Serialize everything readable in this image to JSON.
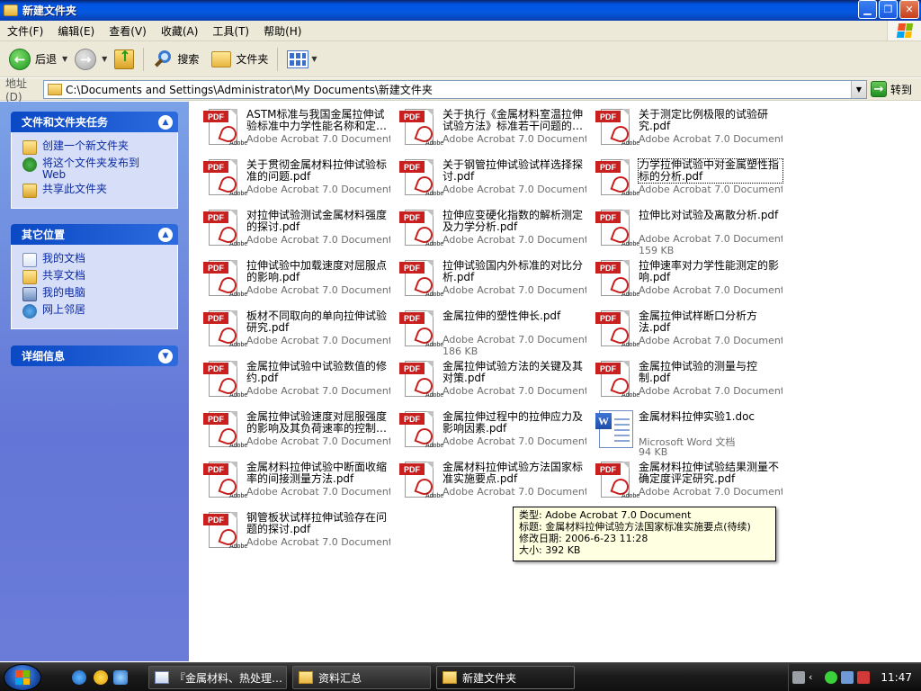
{
  "window": {
    "title": "新建文件夹",
    "controls": {
      "minimize": "▁",
      "maximize": "❐",
      "close": "✕"
    }
  },
  "menu": [
    "文件(F)",
    "编辑(E)",
    "查看(V)",
    "收藏(A)",
    "工具(T)",
    "帮助(H)"
  ],
  "toolbar": {
    "back_label": "后退",
    "search_label": "搜索",
    "folders_label": "文件夹"
  },
  "address": {
    "label": "地址(D)",
    "path": "C:\\Documents and Settings\\Administrator\\My Documents\\新建文件夹",
    "go_label": "转到"
  },
  "taskpane": {
    "file_tasks": {
      "title": "文件和文件夹任务",
      "items": [
        "创建一个新文件夹",
        "将这个文件夹发布到 Web",
        "共享此文件夹"
      ]
    },
    "other_places": {
      "title": "其它位置",
      "items": [
        "我的文档",
        "共享文档",
        "我的电脑",
        "网上邻居"
      ]
    },
    "details": {
      "title": "详细信息"
    }
  },
  "files": [
    {
      "name": "ASTM标准与我国金属拉伸试验标准中力学性能名称和定…",
      "type": "Adobe Acrobat 7.0 Document",
      "kind": "pdf"
    },
    {
      "name": "关于执行《金属材料室温拉伸试验方法》标准若干问题的…",
      "type": "Adobe Acrobat 7.0 Document",
      "kind": "pdf"
    },
    {
      "name": "关于测定比例极限的试验研究.pdf",
      "type": "Adobe Acrobat 7.0 Document",
      "kind": "pdf"
    },
    {
      "name": "关于贯彻金属材料拉伸试验标准的问题.pdf",
      "type": "Adobe Acrobat 7.0 Document",
      "kind": "pdf"
    },
    {
      "name": "关于钢管拉伸试验试样选择探讨.pdf",
      "type": "Adobe Acrobat 7.0 Document",
      "kind": "pdf"
    },
    {
      "name": "力学拉伸试验中对金属塑性指标的分析.pdf",
      "type": "Adobe Acrobat 7.0 Document",
      "kind": "pdf",
      "focused": true
    },
    {
      "name": "对拉伸试验测试金属材料强度的探讨.pdf",
      "type": "Adobe Acrobat 7.0 Document",
      "kind": "pdf"
    },
    {
      "name": "拉伸应变硬化指数的解析测定及力学分析.pdf",
      "type": "Adobe Acrobat 7.0 Document",
      "kind": "pdf"
    },
    {
      "name": "拉伸比对试验及离散分析.pdf",
      "type": "Adobe Acrobat 7.0 Document",
      "size": "159 KB",
      "kind": "pdf"
    },
    {
      "name": "拉伸试验中加载速度对屈服点的影响.pdf",
      "type": "Adobe Acrobat 7.0 Document",
      "kind": "pdf"
    },
    {
      "name": "拉伸试验国内外标准的对比分析.pdf",
      "type": "Adobe Acrobat 7.0 Document",
      "kind": "pdf"
    },
    {
      "name": "拉伸速率对力学性能测定的影响.pdf",
      "type": "Adobe Acrobat 7.0 Document",
      "kind": "pdf"
    },
    {
      "name": "板材不同取向的单向拉伸试验研究.pdf",
      "type": "Adobe Acrobat 7.0 Document",
      "kind": "pdf"
    },
    {
      "name": "金属拉伸的塑性伸长.pdf",
      "type": "Adobe Acrobat 7.0 Document",
      "size": "186 KB",
      "kind": "pdf"
    },
    {
      "name": "金属拉伸试样断口分析方法.pdf",
      "type": "Adobe Acrobat 7.0 Document",
      "kind": "pdf"
    },
    {
      "name": "金属拉伸试验中试验数值的修约.pdf",
      "type": "Adobe Acrobat 7.0 Document",
      "kind": "pdf"
    },
    {
      "name": "金属拉伸试验方法的关键及其对策.pdf",
      "type": "Adobe Acrobat 7.0 Document",
      "kind": "pdf"
    },
    {
      "name": "金属拉伸试验的测量与控制.pdf",
      "type": "Adobe Acrobat 7.0 Document",
      "kind": "pdf"
    },
    {
      "name": "金属拉伸试验速度对屈服强度的影响及其负荷速率的控制…",
      "type": "Adobe Acrobat 7.0 Document",
      "kind": "pdf"
    },
    {
      "name": "金属拉伸过程中的拉伸应力及影响因素.pdf",
      "type": "Adobe Acrobat 7.0 Document",
      "kind": "pdf"
    },
    {
      "name": "金属材料拉伸实验1.doc",
      "type": "Microsoft Word 文档",
      "size": "94 KB",
      "kind": "doc"
    },
    {
      "name": "金属材料拉伸试验中断面收缩率的间接测量方法.pdf",
      "type": "Adobe Acrobat 7.0 Document",
      "kind": "pdf"
    },
    {
      "name": "金属材料拉伸试验方法国家标准实施要点.pdf",
      "type": "Adobe Acrobat 7.0 Document",
      "kind": "pdf"
    },
    {
      "name": "金属材料拉伸试验结果测量不确定度评定研究.pdf",
      "type": "Adobe Acrobat 7.0 Document",
      "kind": "pdf"
    },
    {
      "name": "钢管板状试样拉伸试验存在问题的探讨.pdf",
      "type": "Adobe Acrobat 7.0 Document",
      "kind": "pdf"
    }
  ],
  "tooltip": {
    "type": "类型: Adobe Acrobat 7.0 Document",
    "title": "标题: 金属材料拉伸试验方法国家标准实施要点(待续)",
    "modified": "修改日期: 2006-6-23 11:28",
    "size": "大小: 392 KB"
  },
  "taskbar": {
    "tasks": [
      {
        "label": "『金属材料、热处理…",
        "icon": "doc"
      },
      {
        "label": "资料汇总",
        "icon": "folder"
      },
      {
        "label": "新建文件夹",
        "icon": "folder",
        "active": true
      }
    ],
    "clock": "11:47"
  },
  "colors": {
    "title_bar": "#0054e3",
    "task_pane": "#6375d6",
    "pdf_red": "#c8201e",
    "link": "#0c2aa2"
  },
  "icons": {
    "pdf": "pdf-file-icon",
    "doc": "word-file-icon"
  }
}
